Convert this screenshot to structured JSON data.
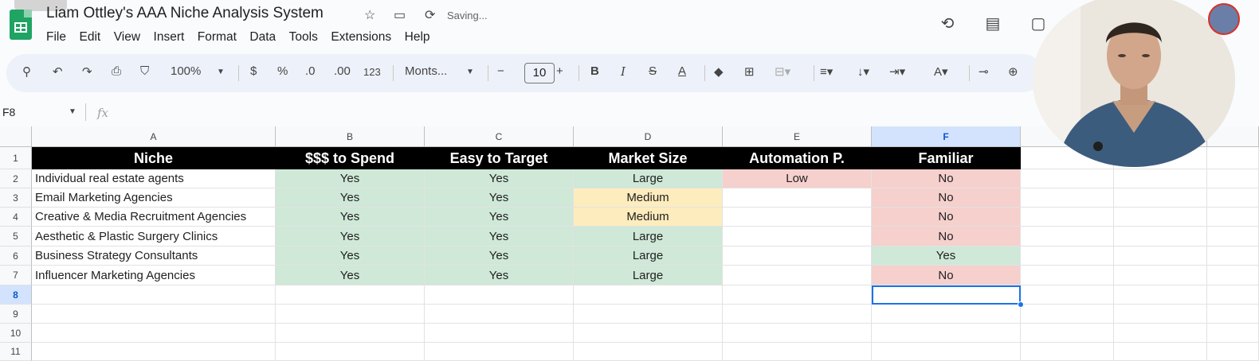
{
  "app": {
    "title": "Liam Ottley's AAA Niche Analysis System",
    "status": "Saving...",
    "menu": [
      "File",
      "Edit",
      "View",
      "Insert",
      "Format",
      "Data",
      "Tools",
      "Extensions",
      "Help"
    ]
  },
  "toolbar": {
    "zoom": "100%",
    "currency": "$",
    "percent": "%",
    "decrease_decimal": ".0",
    "increase_decimal": ".00",
    "number_format": "123",
    "font": "Monts...",
    "font_size": "10",
    "bold": "B",
    "italic": "I",
    "text_color": "A"
  },
  "formula_bar": {
    "name_box": "F8",
    "fx": "fx"
  },
  "sheet": {
    "columns": [
      "A",
      "B",
      "C",
      "D",
      "E",
      "F"
    ],
    "rows": [
      "1",
      "2",
      "3",
      "4",
      "5",
      "6",
      "7",
      "8",
      "9",
      "10",
      "11"
    ],
    "headers": [
      "Niche",
      "$$$ to Spend",
      "Easy to Target",
      "Market Size",
      "Automation P.",
      "Familiar"
    ],
    "data": [
      [
        "Individual real estate agents",
        "Yes",
        "Yes",
        "Large",
        "Low",
        "No"
      ],
      [
        "Email Marketing Agencies",
        "Yes",
        "Yes",
        "Medium",
        "",
        "No"
      ],
      [
        "Creative & Media Recruitment Agencies",
        "Yes",
        "Yes",
        "Medium",
        "",
        "No"
      ],
      [
        "Aesthetic & Plastic Surgery Clinics",
        "Yes",
        "Yes",
        "Large",
        "",
        "No"
      ],
      [
        "Business Strategy Consultants",
        "Yes",
        "Yes",
        "Large",
        "",
        "Yes"
      ],
      [
        "Influencer Marketing Agencies",
        "Yes",
        "Yes",
        "Large",
        "",
        "No"
      ]
    ],
    "selected_cell": "F8"
  },
  "colors": {
    "good": "#cfe8d8",
    "medium": "#fdecbd",
    "bad": "#f5d0cc",
    "header_bg": "#000000",
    "selection": "#1a73e8"
  }
}
